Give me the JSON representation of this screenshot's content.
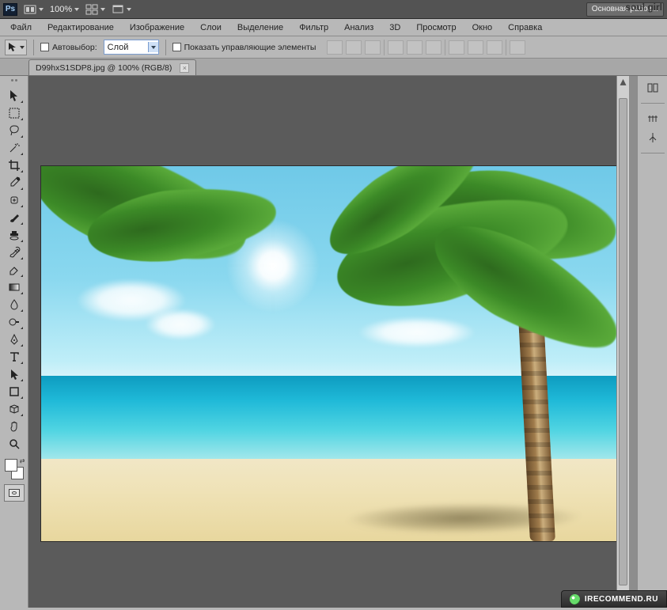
{
  "watermark_user": "soul girl",
  "watermark_site": "IRECOMMEND.RU",
  "app": {
    "logo_text": "Ps",
    "zoom": "100%",
    "workspace_button": "Основная рабоч..."
  },
  "menu": {
    "items": [
      "Файл",
      "Редактирование",
      "Изображение",
      "Слои",
      "Выделение",
      "Фильтр",
      "Анализ",
      "3D",
      "Просмотр",
      "Окно",
      "Справка"
    ]
  },
  "options": {
    "auto_select_label": "Автовыбор:",
    "auto_select_value": "Слой",
    "show_controls_label": "Показать управляющие элементы"
  },
  "document": {
    "tab_label": "D99hxS1SDP8.jpg @ 100% (RGB/8)"
  },
  "tools": [
    {
      "name": "move-tool"
    },
    {
      "name": "marquee-tool"
    },
    {
      "name": "lasso-tool"
    },
    {
      "name": "magic-wand-tool"
    },
    {
      "name": "crop-tool"
    },
    {
      "name": "eyedropper-tool"
    },
    {
      "name": "healing-brush-tool"
    },
    {
      "name": "brush-tool"
    },
    {
      "name": "clone-stamp-tool"
    },
    {
      "name": "history-brush-tool"
    },
    {
      "name": "eraser-tool"
    },
    {
      "name": "gradient-tool"
    },
    {
      "name": "blur-tool"
    },
    {
      "name": "dodge-tool"
    },
    {
      "name": "pen-tool"
    },
    {
      "name": "type-tool"
    },
    {
      "name": "path-selection-tool"
    },
    {
      "name": "shape-tool"
    },
    {
      "name": "3d-tool"
    },
    {
      "name": "hand-tool"
    },
    {
      "name": "zoom-tool"
    }
  ]
}
